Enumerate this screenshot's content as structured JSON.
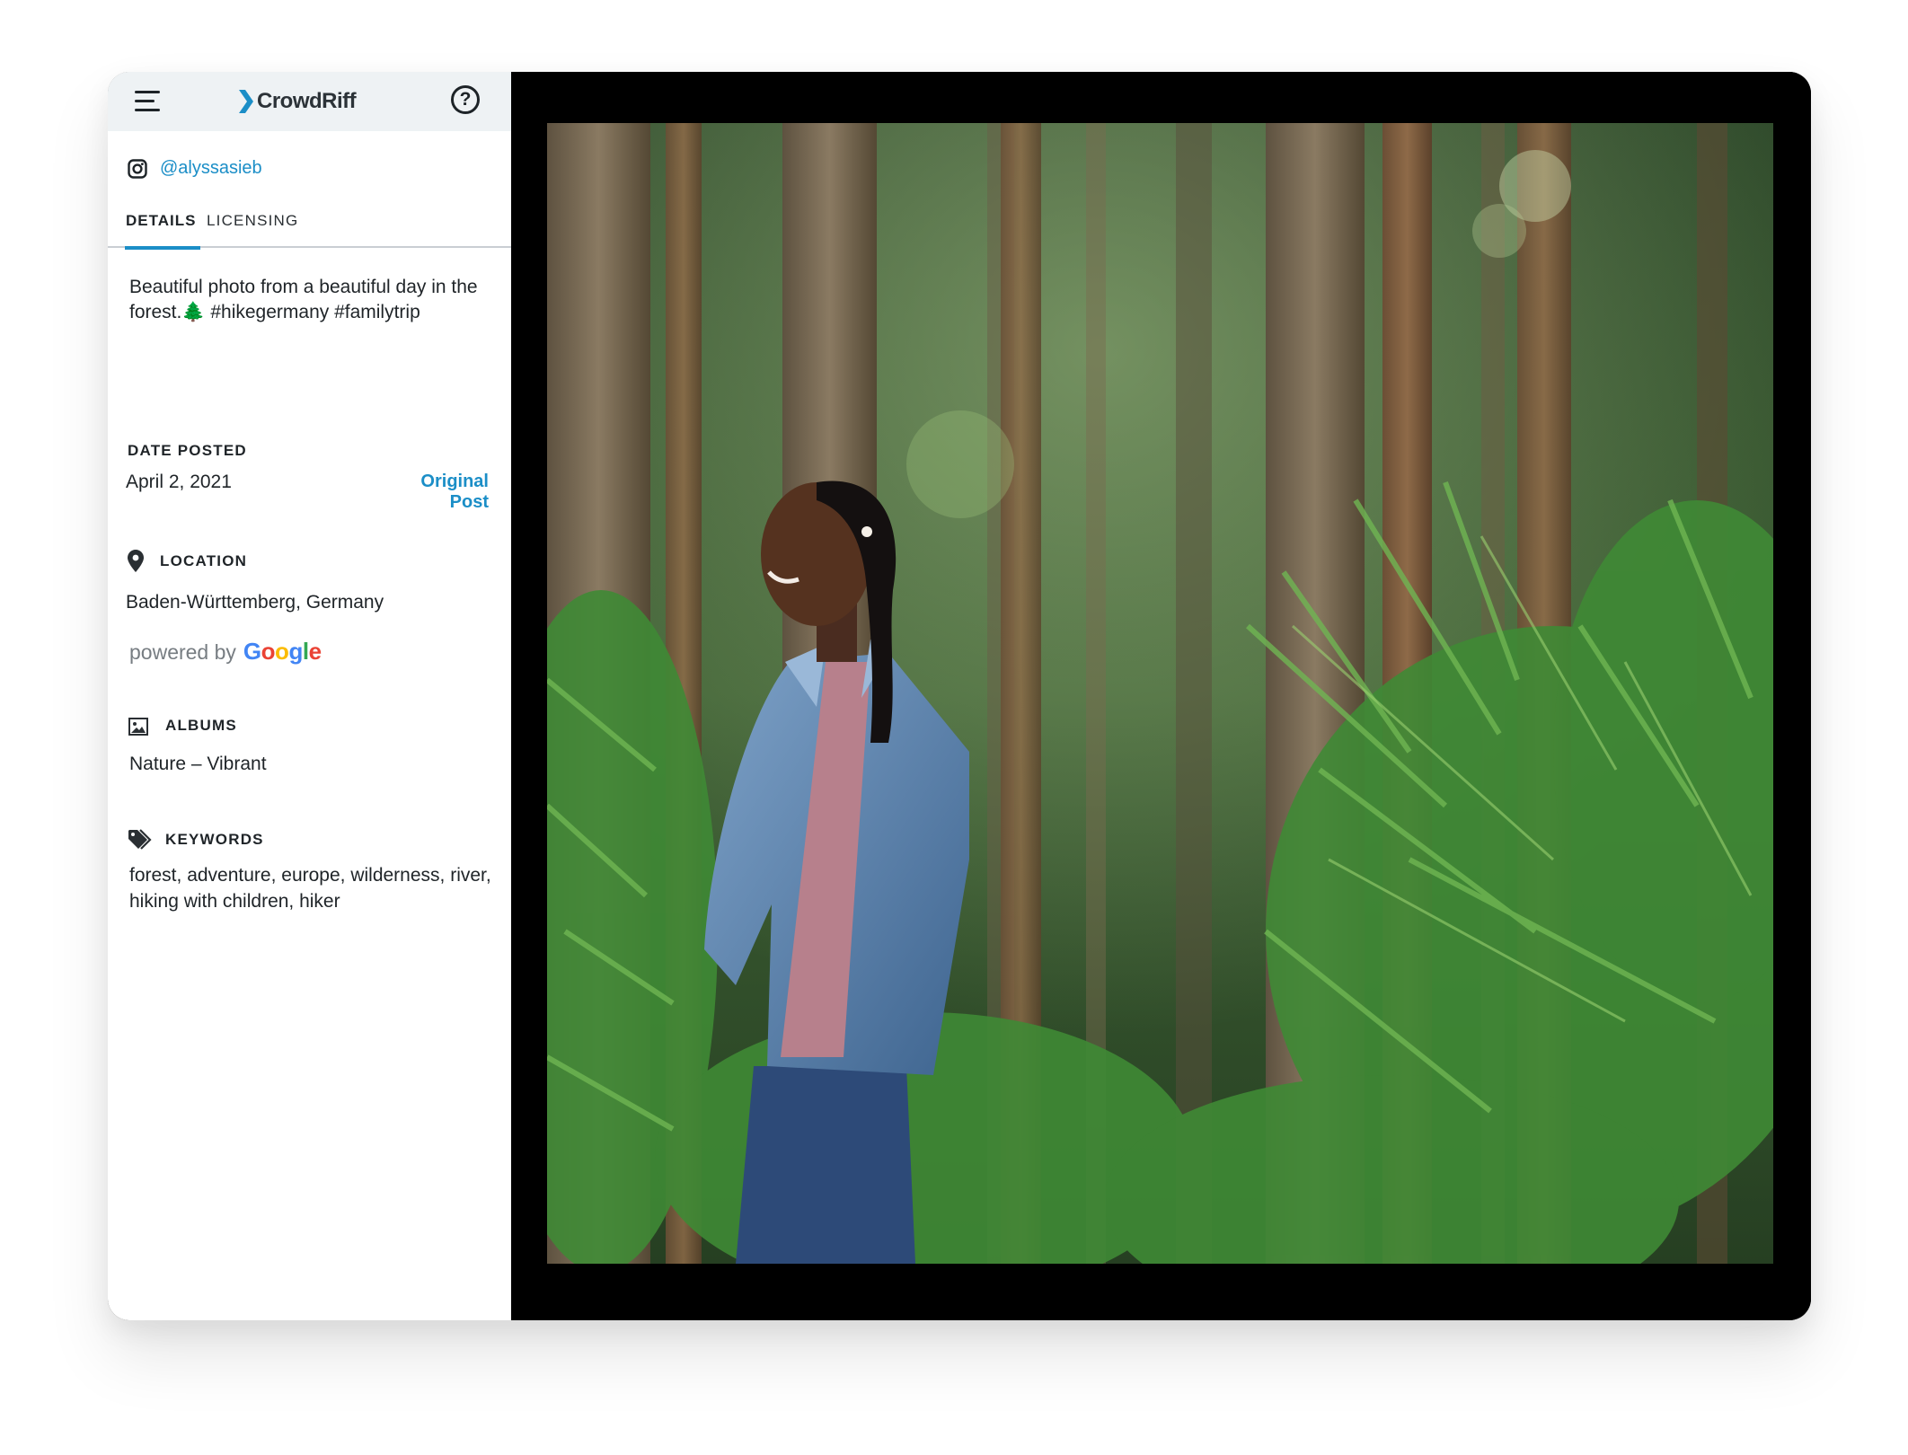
{
  "header": {
    "brand": "CrowdRiff",
    "help_label": "?"
  },
  "post": {
    "handle": "@alyssasieb",
    "caption": "Beautiful photo from a beautiful day in the forest.🌲 #hikegermany #familytrip"
  },
  "tabs": [
    {
      "label": "DETAILS",
      "active": true
    },
    {
      "label": "LICENSING",
      "active": false
    }
  ],
  "date_posted": {
    "label": "DATE POSTED",
    "value": "April 2, 2021",
    "link_label": "Original Post"
  },
  "location": {
    "label": "LOCATION",
    "value": "Baden-Württemberg, Germany",
    "powered_by": "powered by",
    "google_letters": [
      "G",
      "o",
      "o",
      "g",
      "l",
      "e"
    ]
  },
  "albums": {
    "label": "ALBUMS",
    "value": "Nature – Vibrant"
  },
  "keywords": {
    "label": "KEYWORDS",
    "value": "forest, adventure, europe, wilderness, river, hiking with children, hiker"
  },
  "colors": {
    "accent": "#1b8ec7",
    "header_bg": "#eef2f4",
    "viewer_bg": "#000000"
  },
  "icons": [
    "menu-icon",
    "logo-mark",
    "help-icon",
    "instagram-icon",
    "location-pin-icon",
    "album-icon",
    "tag-icon"
  ]
}
